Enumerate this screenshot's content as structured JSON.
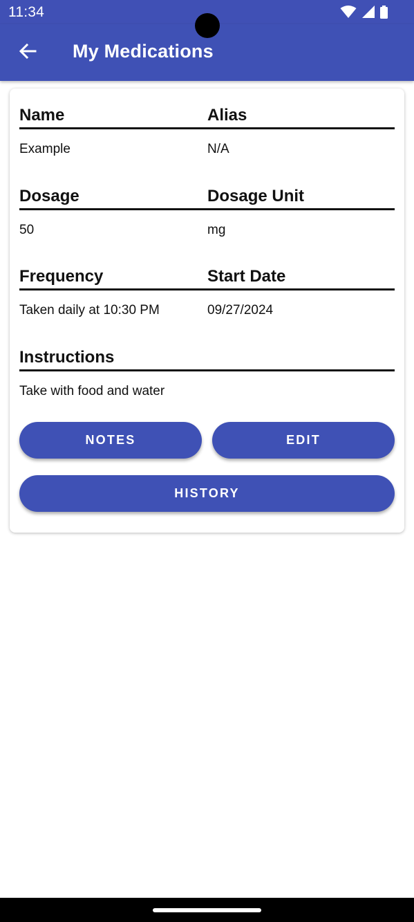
{
  "status_bar": {
    "time": "11:34",
    "icons": [
      "wifi-icon",
      "signal-icon",
      "battery-icon"
    ]
  },
  "app_bar": {
    "back_icon": "arrow-back-icon",
    "title": "My Medications"
  },
  "medication": {
    "name_header": "Name",
    "alias_header": "Alias",
    "name_value": "Example",
    "alias_value": "N/A",
    "dosage_header": "Dosage",
    "dosage_unit_header": "Dosage Unit",
    "dosage_value": "50",
    "dosage_unit_value": "mg",
    "frequency_header": "Frequency",
    "start_date_header": "Start Date",
    "frequency_value": "Taken daily at 10:30 PM",
    "start_date_value": "09/27/2024",
    "instructions_header": "Instructions",
    "instructions_value": "Take with food and water"
  },
  "buttons": {
    "notes": "NOTES",
    "edit": "EDIT",
    "history": "HISTORY"
  },
  "colors": {
    "primary": "#3f51b5",
    "status_bar": "#4050b5",
    "text": "#111111",
    "nav_bar": "#000000"
  }
}
